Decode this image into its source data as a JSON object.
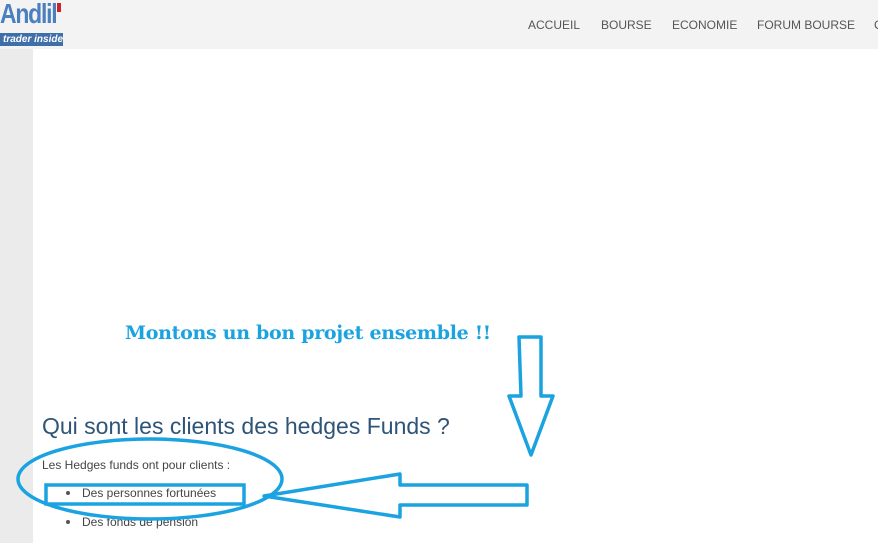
{
  "logo": {
    "word": "Andlil",
    "tagline": "trader inside"
  },
  "nav": {
    "items": [
      {
        "label": "ACCUEIL"
      },
      {
        "label": "BOURSE"
      },
      {
        "label": "ECONOMIE"
      },
      {
        "label": "FORUM BOURSE"
      },
      {
        "label": "C"
      }
    ]
  },
  "annotation": {
    "text": "Montons un bon projet ensemble !!",
    "color": "#1aa3e0"
  },
  "article": {
    "title": "Qui sont les clients des hedges Funds ?",
    "intro": "Les Hedges funds ont pour clients :",
    "list": [
      "Des personnes fortunées",
      "Des fonds de pension"
    ]
  },
  "colors": {
    "header_bg": "#f3f3f3",
    "page_bg": "#ebebeb",
    "title": "#2e5478",
    "annotation": "#1aa3e0"
  }
}
